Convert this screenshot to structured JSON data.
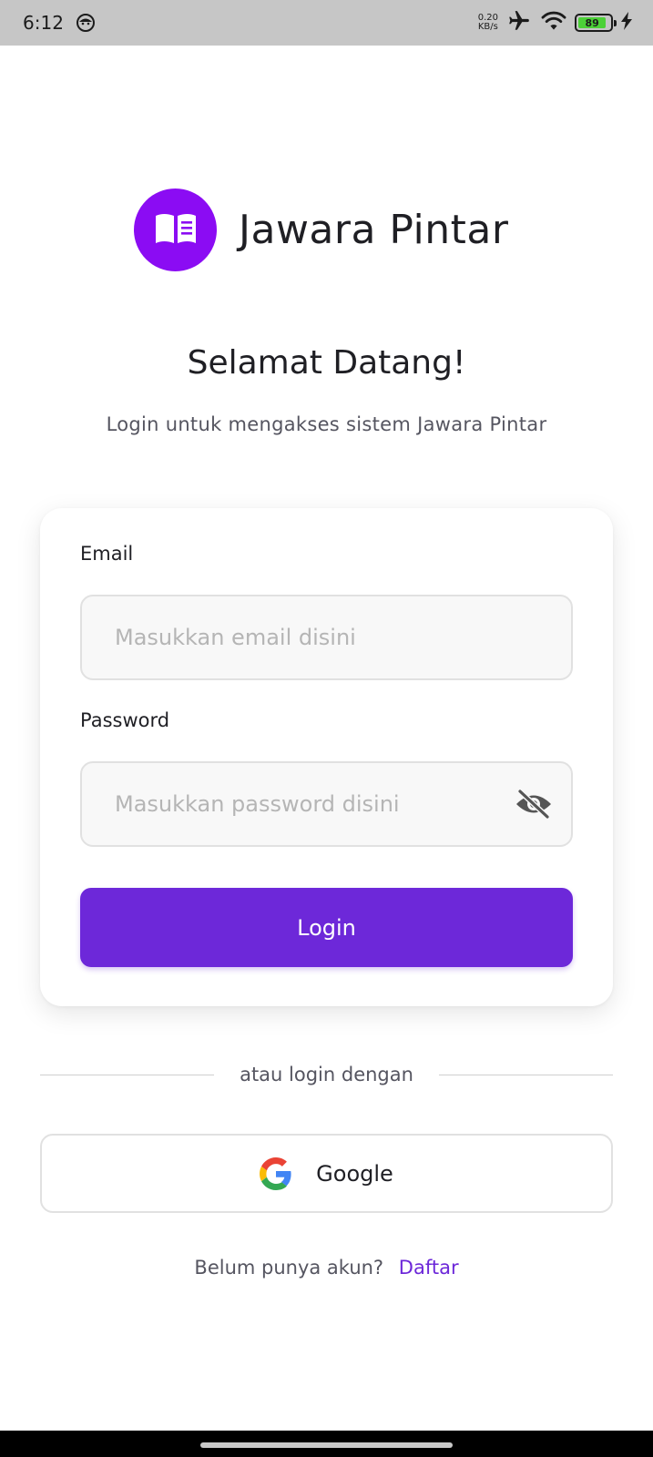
{
  "status_bar": {
    "time": "6:12",
    "net_speed_value": "0.20",
    "net_speed_unit": "KB/s",
    "battery_level": "89",
    "icons": [
      "face-icon",
      "airplane-mode-icon",
      "wifi-icon",
      "battery-icon",
      "charging-icon"
    ]
  },
  "brand": {
    "name": "Jawara Pintar",
    "logo_icon": "book-icon",
    "color": "#8b0cf3"
  },
  "header": {
    "title": "Selamat Datang!",
    "subtitle": "Login untuk mengakses sistem Jawara Pintar"
  },
  "form": {
    "email_label": "Email",
    "email_placeholder": "Masukkan email disini",
    "email_value": "",
    "password_label": "Password",
    "password_placeholder": "Masukkan password disini",
    "password_value": "",
    "password_toggle_icon": "eye-off-icon",
    "login_label": "Login"
  },
  "divider_text": "atau login dengan",
  "google": {
    "label": "Google",
    "icon": "google-icon"
  },
  "signup": {
    "prompt": "Belum punya akun?",
    "link": "Daftar"
  },
  "colors": {
    "accent": "#6d28d9",
    "brand": "#8b0cf3"
  }
}
